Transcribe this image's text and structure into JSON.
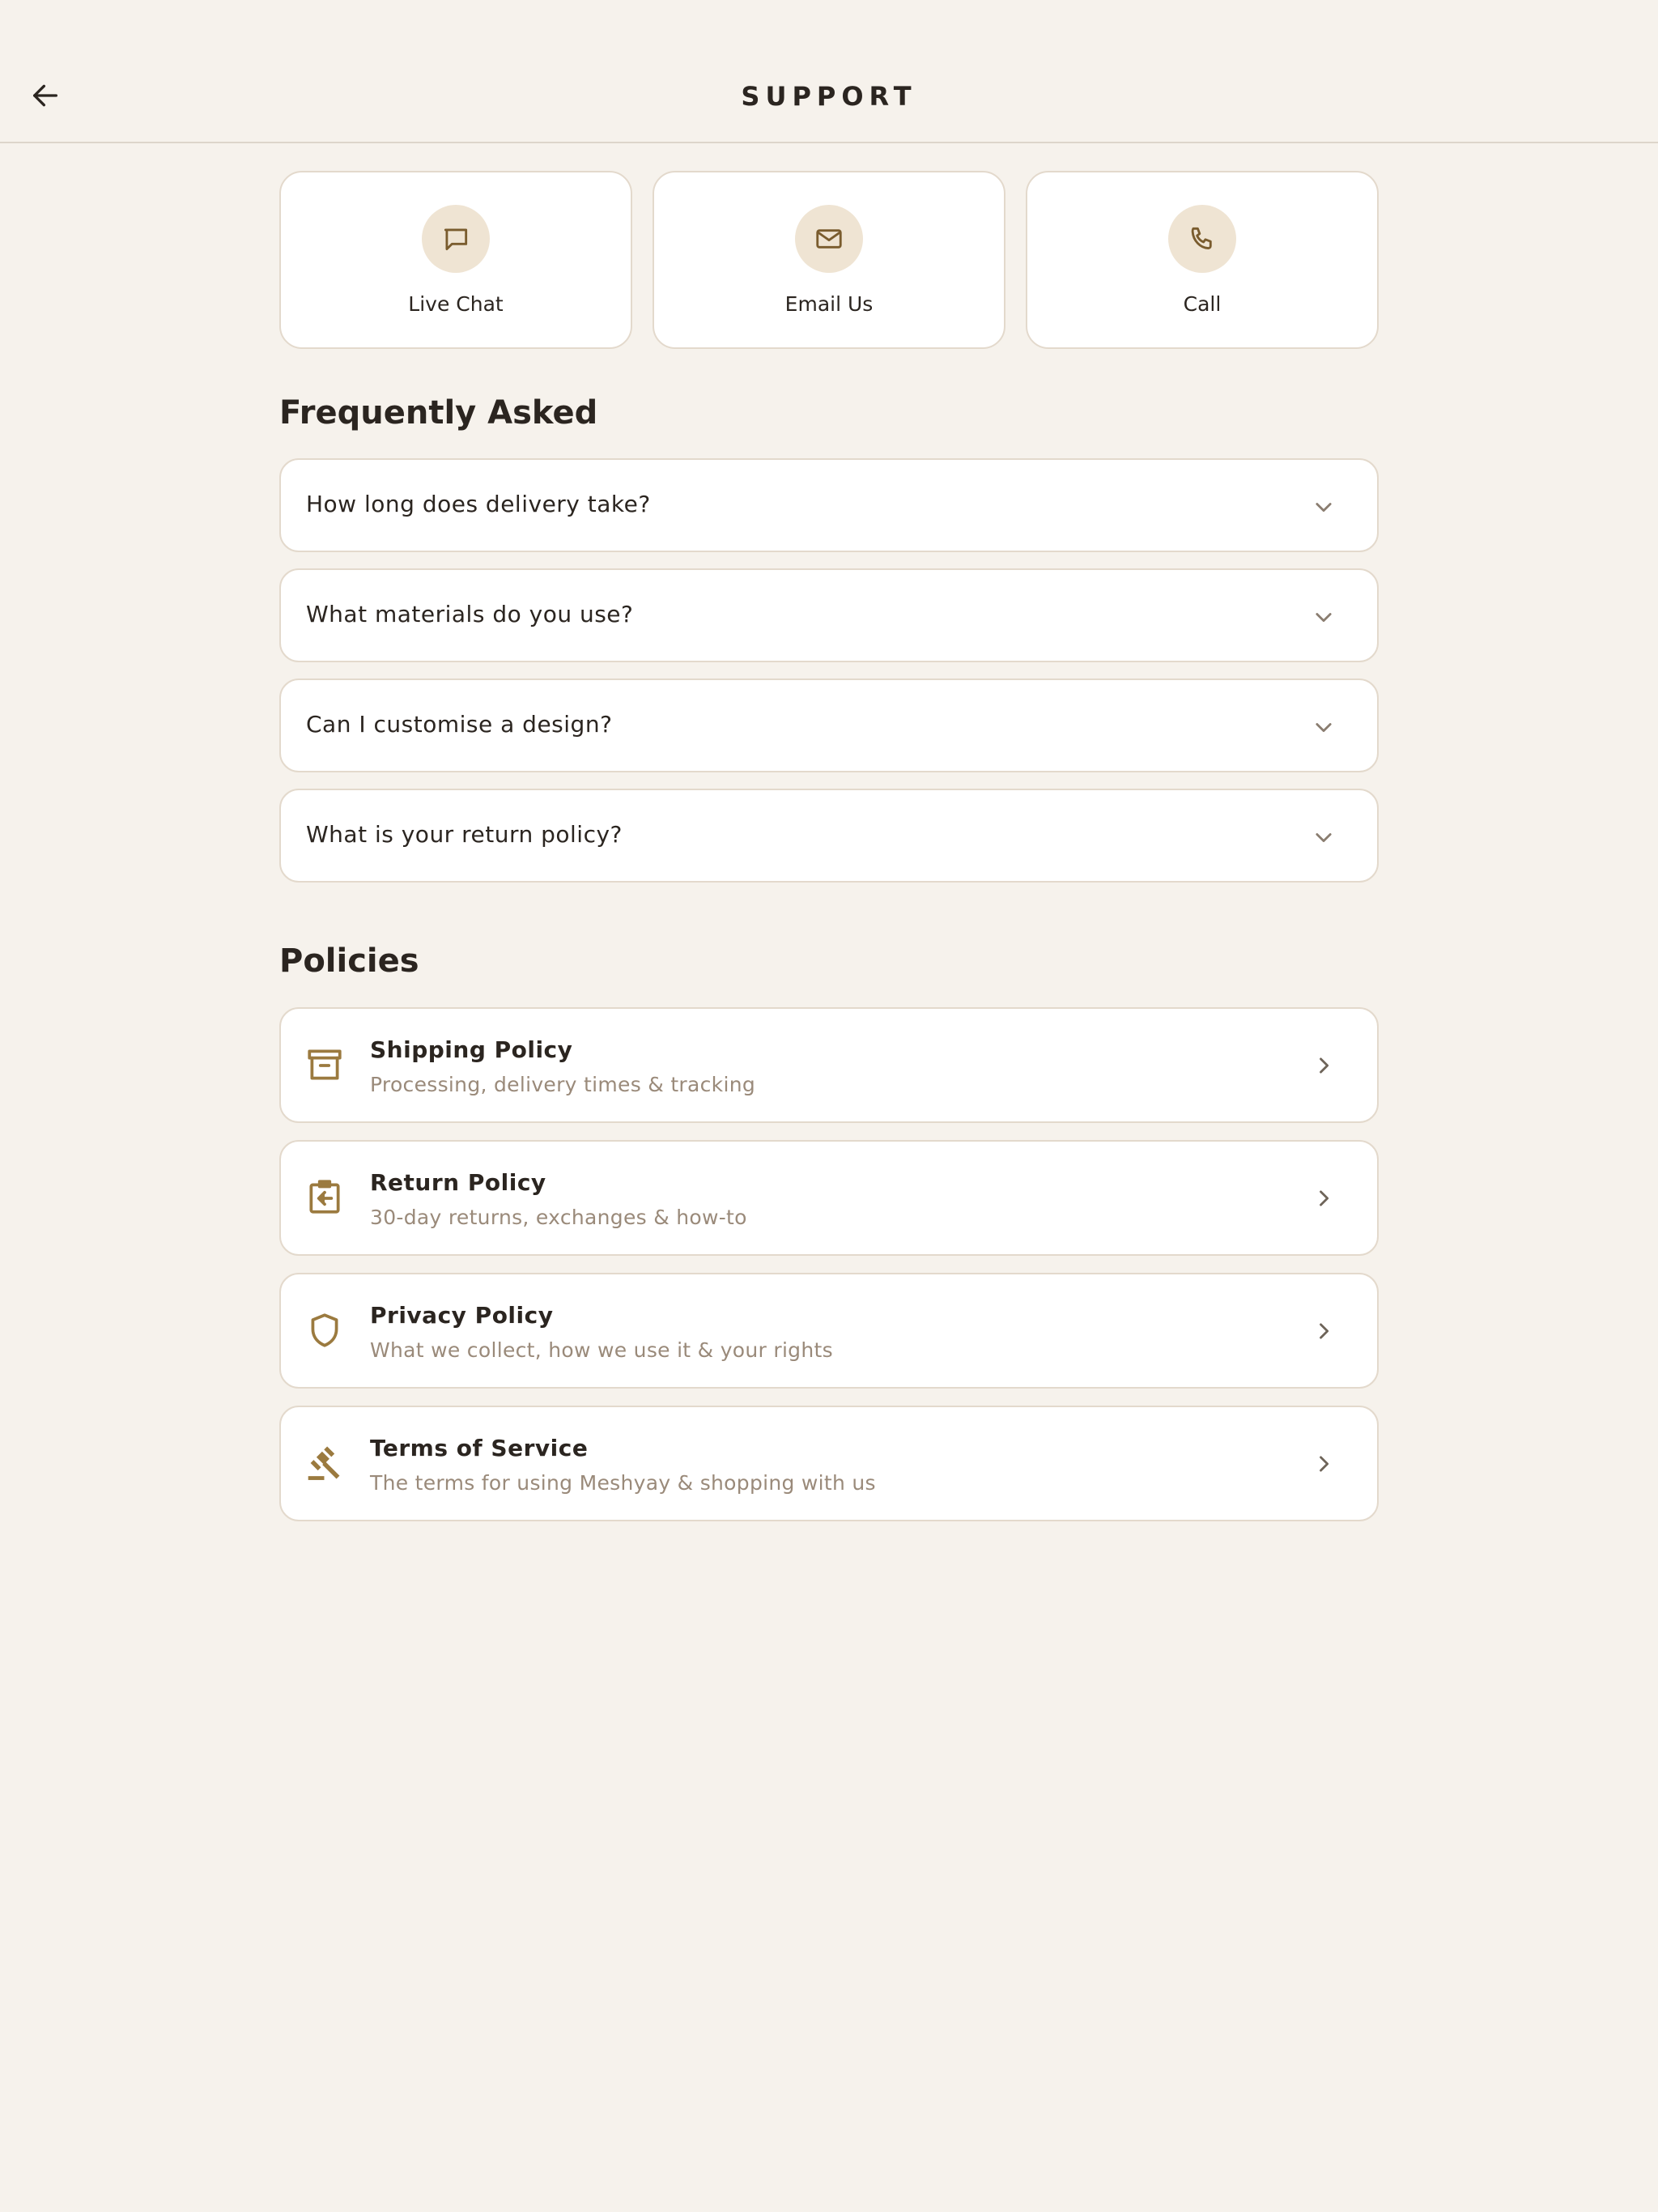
{
  "header": {
    "title": "SUPPORT",
    "back_icon": "arrow-left-icon"
  },
  "contact_options": [
    {
      "label": "Live Chat",
      "icon": "chat-bubble-icon"
    },
    {
      "label": "Email Us",
      "icon": "envelope-icon"
    },
    {
      "label": "Call",
      "icon": "phone-icon"
    }
  ],
  "faq": {
    "title": "Frequently Asked",
    "items": [
      {
        "question": "How long does delivery take?",
        "icon": "chevron-down-icon"
      },
      {
        "question": "What materials do you use?",
        "icon": "chevron-down-icon"
      },
      {
        "question": "Can I customise a design?",
        "icon": "chevron-down-icon"
      },
      {
        "question": "What is your return policy?",
        "icon": "chevron-down-icon"
      }
    ]
  },
  "policies": {
    "title": "Policies",
    "items": [
      {
        "title": "Shipping Policy",
        "subtitle": "Processing, delivery times & tracking",
        "icon": "archive-box-icon"
      },
      {
        "title": "Return Policy",
        "subtitle": "30-day returns, exchanges & how-to",
        "icon": "return-clipboard-icon"
      },
      {
        "title": "Privacy Policy",
        "subtitle": "What we collect, how we use it & your rights",
        "icon": "shield-icon"
      },
      {
        "title": "Terms of Service",
        "subtitle": "The terms for using Meshyay & shopping with us",
        "icon": "gavel-icon"
      }
    ]
  },
  "colors": {
    "background": "#f6f2ec",
    "card": "#ffffff",
    "border": "#e3d9cc",
    "accent": "#9b7a3f",
    "icon_bg": "#efe4d3",
    "text": "#2b2520",
    "muted": "#9a8a7a"
  }
}
